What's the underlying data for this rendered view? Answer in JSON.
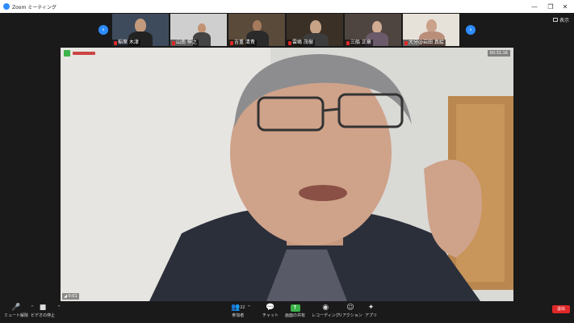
{
  "window": {
    "title": "Zoom ミーティング",
    "controls": [
      "—",
      "❐",
      "✕"
    ]
  },
  "view_button": {
    "label": "表示"
  },
  "thumbnails": [
    {
      "name": "稲葉 木津",
      "bg": "#3e4b5c",
      "face": "#c49a7c"
    },
    {
      "name": "山南 伸之",
      "bg": "#cfcfcf",
      "face": "#c29274"
    },
    {
      "name": "吉重 清貴",
      "bg": "#5a4a3a",
      "face": "#a67a5c"
    },
    {
      "name": "雲嶋 茂樹",
      "bg": "#3a3026",
      "face": "#c8a386"
    },
    {
      "name": "三船 正章",
      "bg": "#4e4540",
      "face": "#d1ab92"
    },
    {
      "name": "大分@岩田 真絵",
      "bg": "#e6e2da",
      "face": "#caa18a"
    }
  ],
  "main_video": {
    "timer": "00:31:16",
    "signal": "◢ 0:01"
  },
  "toolbar": {
    "mute": {
      "label": "ミュート解除",
      "icon": "🎤"
    },
    "video": {
      "label": "ビデオの停止",
      "icon": "■"
    },
    "participants": {
      "label": "参加者",
      "count": "22",
      "icon": "👥"
    },
    "chat": {
      "label": "チャット",
      "icon": "💬"
    },
    "share": {
      "label": "画面の共有",
      "icon": "↑"
    },
    "record": {
      "label": "レコーディング",
      "icon": "◉"
    },
    "reactions": {
      "label": "リアクション",
      "icon": "☺"
    },
    "apps": {
      "label": "アプリ",
      "icon": "✦"
    },
    "leave": {
      "label": "退出"
    }
  },
  "colors": {
    "accent": "#2d8cff",
    "leave": "#e02828",
    "share": "#3bb34a"
  }
}
